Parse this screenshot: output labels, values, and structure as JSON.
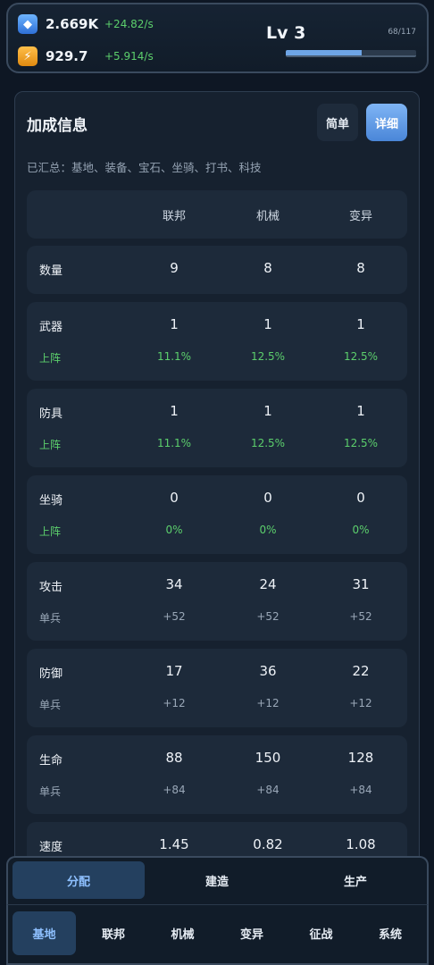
{
  "resources": {
    "gems": {
      "value": "2.669K",
      "rate": "+24.82/s",
      "icon": "gem-icon"
    },
    "energy": {
      "value": "929.7",
      "rate": "+5.914/s",
      "icon": "lightning-icon"
    }
  },
  "level": {
    "label": "Lv 3",
    "xp_text": "68/117",
    "progress": 0.581
  },
  "panel": {
    "title": "加成信息",
    "simple_label": "简单",
    "detail_label": "详细",
    "summary": "已汇总：基地、装备、宝石、坐骑、打书、科技"
  },
  "table": {
    "columns": [
      "联邦",
      "机械",
      "变异"
    ],
    "rows": [
      {
        "label": "数量",
        "values": [
          "9",
          "8",
          "8"
        ]
      },
      {
        "label": "武器",
        "values": [
          "1",
          "1",
          "1"
        ],
        "sub_label": "上阵",
        "sub_values": [
          "11.1%",
          "12.5%",
          "12.5%"
        ],
        "sub_style": "green"
      },
      {
        "label": "防具",
        "values": [
          "1",
          "1",
          "1"
        ],
        "sub_label": "上阵",
        "sub_values": [
          "11.1%",
          "12.5%",
          "12.5%"
        ],
        "sub_style": "green"
      },
      {
        "label": "坐骑",
        "values": [
          "0",
          "0",
          "0"
        ],
        "sub_label": "上阵",
        "sub_values": [
          "0%",
          "0%",
          "0%"
        ],
        "sub_style": "green"
      },
      {
        "label": "攻击",
        "values": [
          "34",
          "24",
          "31"
        ],
        "sub_label": "单兵",
        "sub_values": [
          "+52",
          "+52",
          "+52"
        ],
        "sub_style": "grey"
      },
      {
        "label": "防御",
        "values": [
          "17",
          "36",
          "22"
        ],
        "sub_label": "单兵",
        "sub_values": [
          "+12",
          "+12",
          "+12"
        ],
        "sub_style": "grey"
      },
      {
        "label": "生命",
        "values": [
          "88",
          "150",
          "128"
        ],
        "sub_label": "单兵",
        "sub_values": [
          "+84",
          "+84",
          "+84"
        ],
        "sub_style": "grey"
      },
      {
        "label": "速度",
        "values": [
          "1.45",
          "0.82",
          "1.08"
        ]
      }
    ]
  },
  "sub_tabs": [
    "分配",
    "建造",
    "生产"
  ],
  "active_sub_tab": 0,
  "main_tabs": [
    "基地",
    "联邦",
    "机械",
    "变异",
    "征战",
    "系统"
  ],
  "active_main_tab": 0,
  "colors": {
    "accent": "#6ea5e6",
    "positive": "#5ccf6c",
    "background": "#0e1724"
  }
}
